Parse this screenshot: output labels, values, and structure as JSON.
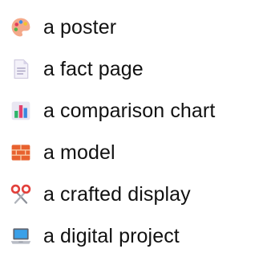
{
  "items": [
    {
      "label": "a poster",
      "icon": "artist-palette-icon"
    },
    {
      "label": "a fact page",
      "icon": "page-facing-up-icon"
    },
    {
      "label": "a comparison chart",
      "icon": "bar-chart-icon"
    },
    {
      "label": "a model",
      "icon": "brick-icon"
    },
    {
      "label": "a crafted display",
      "icon": "scissors-icon"
    },
    {
      "label": "a digital project",
      "icon": "laptop-icon"
    }
  ],
  "colors": {
    "text": "#111111",
    "palette": "#f4a98a",
    "page": "#dcd8ea",
    "brick": "#e8622f",
    "scissors": "#e2403b",
    "laptop_screen": "#3aa0e8"
  }
}
